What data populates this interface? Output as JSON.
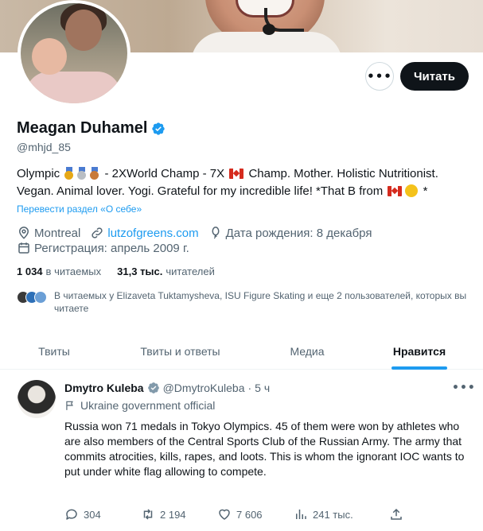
{
  "profile": {
    "name": "Meagan Duhamel",
    "handle": "@mhjd_85",
    "follow_label": "Читать",
    "more_label": "•••",
    "bio_part1": "Olympic ",
    "bio_part2": " - 2XWorld Champ - 7X ",
    "bio_part3": " Champ. Mother. Holistic Nutritionist. Vegan. Animal lover. Yogi. Grateful for my incredible life! *That B from ",
    "bio_part4": " *",
    "translate_label": "Перевести раздел «О себе»",
    "location": "Montreal",
    "website": "lutzofgreens.com",
    "birthday": "Дата рождения: 8 декабря",
    "joined": "Регистрация: апрель 2009 г.",
    "following_count": "1 034",
    "following_label": "в читаемых",
    "followers_count": "31,3 тыс.",
    "followers_label": "читателей",
    "followed_by_text": "В читаемых у Elizaveta Tuktamysheva, ISU Figure Skating и еще 2 пользователей, которых вы читаете"
  },
  "tabs": [
    {
      "label": "Твиты",
      "active": false
    },
    {
      "label": "Твиты и ответы",
      "active": false
    },
    {
      "label": "Медиа",
      "active": false
    },
    {
      "label": "Нравится",
      "active": true
    }
  ],
  "tweet": {
    "author": "Dmytro Kuleba",
    "handle": "@DmytroKuleba",
    "separator": "·",
    "time": "5 ч",
    "label": "Ukraine government official",
    "text": "Russia won 71 medals in Tokyo Olympics. 45 of them were won by athletes who are also members of the Central Sports Club of the Russian Army. The army that commits atrocities, kills, rapes, and loots. This is whom the ignorant IOC wants to put under white flag allowing to compete.",
    "replies": "304",
    "retweets": "2 194",
    "likes": "7 606",
    "views": "241 тыс.",
    "more_label": "•••"
  },
  "colors": {
    "accent": "#1d9bf0",
    "text": "#0f1419",
    "secondary": "#536471",
    "follow_button": "#0f1419"
  }
}
